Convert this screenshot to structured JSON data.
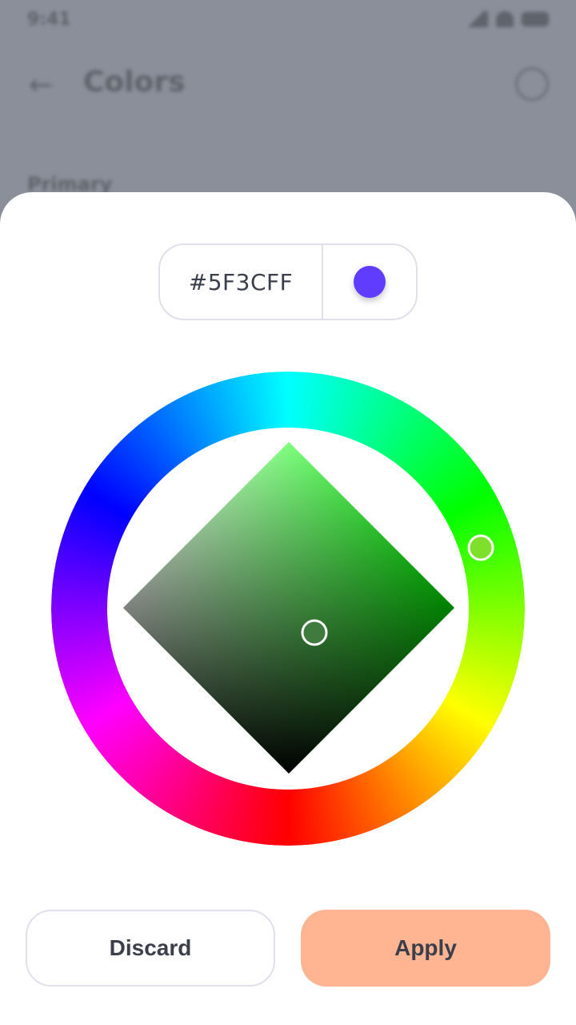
{
  "status_bar": {
    "time": "9:41"
  },
  "app_bar": {
    "title": "Colors"
  },
  "section": {
    "label": "Primary"
  },
  "picker": {
    "hex_value": "#5F3CFF",
    "swatch_color": "#5F3CFF",
    "ring_selector_color": "#7ee02a",
    "sv_hue_color": "#00ff00",
    "sv_selector_color": "#3f7a3f"
  },
  "actions": {
    "discard_label": "Discard",
    "apply_label": "Apply",
    "apply_color": "#ffb592"
  },
  "colors": {
    "scrim": "#8b8f99",
    "border": "#dfe0ea",
    "text": "#3a3f4b"
  }
}
